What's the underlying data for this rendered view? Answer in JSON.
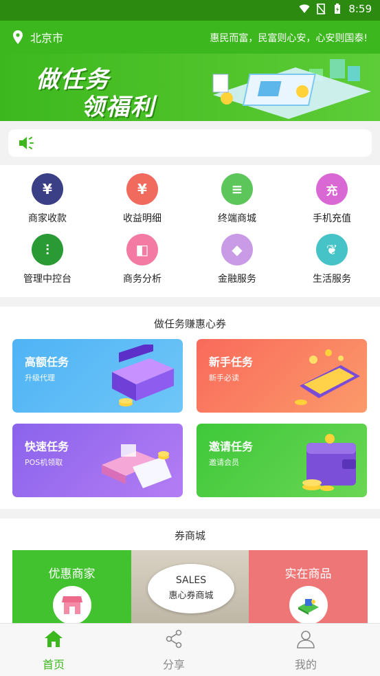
{
  "status_bar": {
    "time": "8:59",
    "icons": [
      "wifi-icon",
      "signal-off-icon",
      "battery-icon"
    ]
  },
  "top_bar": {
    "city": "北京市",
    "slogan": "惠民而富，民富则心安，心安则国泰!",
    "location_icon": "location-pin-icon"
  },
  "banner": {
    "line1": "做任务",
    "line2": "领福利"
  },
  "notice": {
    "icon": "speaker-icon",
    "text": ""
  },
  "menu": [
    {
      "label": "商家收款",
      "icon": "yen-icon",
      "color": "#3b3f86",
      "glyph": "¥"
    },
    {
      "label": "收益明细",
      "icon": "income-hand-icon",
      "color": "#f06a5e",
      "glyph": "¥"
    },
    {
      "label": "终端商城",
      "icon": "terminal-mall-icon",
      "color": "#5cc65a",
      "glyph": "≡"
    },
    {
      "label": "手机充值",
      "icon": "recharge-icon",
      "color": "#d968d4",
      "glyph": "充"
    },
    {
      "label": "管理中控台",
      "icon": "control-sliders-icon",
      "color": "#2a9a35",
      "glyph": "⫶"
    },
    {
      "label": "商务分析",
      "icon": "analysis-icon",
      "color": "#f27aa3",
      "glyph": "◧"
    },
    {
      "label": "金融服务",
      "icon": "diamond-icon",
      "color": "#c99ae6",
      "glyph": "◆"
    },
    {
      "label": "生活服务",
      "icon": "plant-icon",
      "color": "#46c3c6",
      "glyph": "❦"
    }
  ],
  "tasks": {
    "title": "做任务赚惠心券",
    "cards": [
      {
        "title": "高额任务",
        "subtitle": "升级代理",
        "from": "#4fb3f5",
        "to": "#6fc6f7"
      },
      {
        "title": "新手任务",
        "subtitle": "新手必读",
        "from": "#f96a5b",
        "to": "#fb9a6a"
      },
      {
        "title": "快速任务",
        "subtitle": "POS机领取",
        "from": "#8a63ec",
        "to": "#b47df4"
      },
      {
        "title": "邀请任务",
        "subtitle": "邀请会员",
        "from": "#3fc83a",
        "to": "#6ad654"
      }
    ]
  },
  "mall": {
    "title": "券商城",
    "left_label": "优惠商家",
    "center_line1": "SALES",
    "center_line2": "惠心券商城",
    "right_label": "实在商品"
  },
  "tabs": [
    {
      "label": "首页",
      "icon": "home-icon",
      "active": true
    },
    {
      "label": "分享",
      "icon": "share-icon",
      "active": false
    },
    {
      "label": "我的",
      "icon": "profile-icon",
      "active": false
    }
  ],
  "colors": {
    "primary": "#3cb81e",
    "tab_active": "#3cb81e",
    "tab_inactive": "#888888"
  }
}
